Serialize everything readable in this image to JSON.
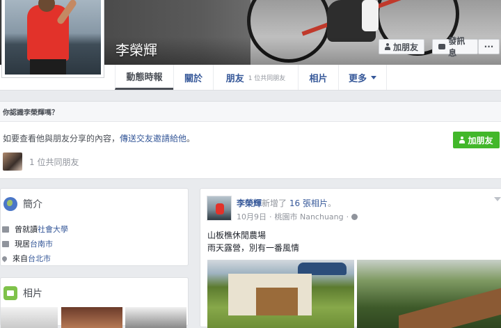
{
  "profile": {
    "name": "李榮輝"
  },
  "cover_buttons": {
    "add_friend": "加朋友",
    "message": "發訊息",
    "more": "···"
  },
  "nav": {
    "tabs": [
      {
        "label": "動態時報"
      },
      {
        "label": "關於"
      },
      {
        "label": "朋友",
        "sub": "1 位共同朋友"
      },
      {
        "label": "相片"
      },
      {
        "label": "更多"
      }
    ]
  },
  "know_box": {
    "heading": "你認識李榮輝嗎？",
    "text_prefix": "如要查看他與朋友分享的內容，",
    "text_link": "傳送交友邀請給他",
    "text_suffix": "。",
    "mutual": "1 位共同朋友",
    "add_button": "加朋友"
  },
  "intro": {
    "title": "簡介",
    "items": [
      {
        "prefix": "曾就讀",
        "link": "社會大學",
        "icon": "education-icon"
      },
      {
        "prefix": "現居",
        "link": "台南市",
        "icon": "home-icon"
      },
      {
        "prefix": "來自",
        "link": "台北市",
        "icon": "location-pin-icon"
      }
    ]
  },
  "photos": {
    "title": "相片"
  },
  "post": {
    "author": "李榮輝",
    "action": "新增了",
    "link": "16 張相片",
    "action_suffix": "。",
    "date": "10月9日",
    "location": "桃園市 Nanchuang",
    "separator": "·",
    "line1": "山板樵休閒農場",
    "line2": "雨天露營，別有一番風情"
  }
}
